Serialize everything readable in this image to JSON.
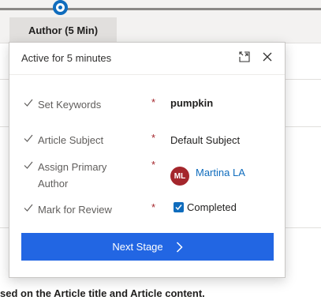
{
  "stage_bar": {
    "active_stage_label": "Author",
    "active_stage_duration": "(5 Min)"
  },
  "flyout": {
    "title": "Active for 5 minutes",
    "expand_icon": "expand-icon",
    "close_icon": "close-icon",
    "steps": [
      {
        "label": "Set Keywords",
        "required_mark": "*",
        "value": "pumpkin",
        "completed": true
      },
      {
        "label": "Article Subject",
        "required_mark": "*",
        "value": "Default Subject",
        "completed": true
      },
      {
        "label": "Assign Primary Author",
        "required_mark": "*",
        "value": "Martina LA",
        "avatar_initials": "ML",
        "completed": true
      },
      {
        "label": "Mark for Review",
        "required_mark": "*",
        "value": "Completed",
        "checked": true,
        "completed": true
      }
    ],
    "next_button_label": "Next Stage"
  },
  "background": {
    "partial_text": "sed on the Article title and Article content."
  },
  "colors": {
    "accent": "#0f6cbd",
    "button": "#2266e3",
    "required": "#a4262c",
    "avatar": "#a4262c"
  }
}
